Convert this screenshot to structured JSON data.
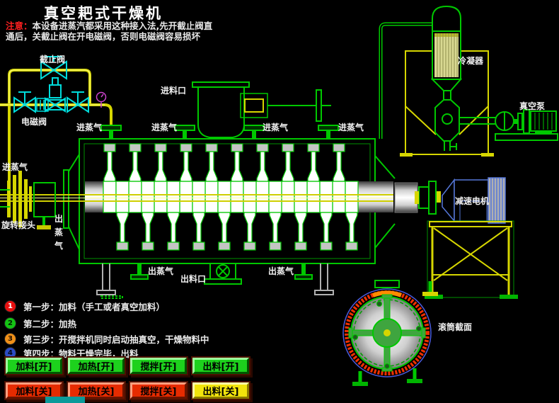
{
  "title": "真空耙式干燥机",
  "warning": {
    "prefix": "注意：",
    "line1": "本设备进蒸汽都采用这种接入法,先开截止阀直",
    "line2": "通后，关截止阀在开电磁阀，否则电磁阀容易损坏"
  },
  "labels": {
    "stop_valve": "截止阀",
    "solenoid_valve": "电磁阀",
    "feed_inlet": "进料口",
    "steam_in": "进蒸气",
    "steam_out": "出蒸气",
    "rotary_joint": "旋转接头",
    "discharge_port": "出料口",
    "condenser": "冷凝器",
    "vacuum_pump": "真空泵",
    "gear_motor": "减速电机",
    "drum_section": "滚筒截面"
  },
  "steps": [
    {
      "num": "1",
      "circle_color": "#e81010",
      "num_color": "#ffffff",
      "text": "第一步：加料（手工或者真空加料）"
    },
    {
      "num": "2",
      "circle_color": "#14c414",
      "num_color": "#002200",
      "text": "第二步：加热"
    },
    {
      "num": "3",
      "circle_color": "#f09018",
      "num_color": "#201000",
      "text": "第三步：开搅拌机同时启动抽真空，干燥物料中"
    },
    {
      "num": "4",
      "circle_color": "#2c4cc4",
      "num_color": "#000818",
      "text": "第四步：物料干燥完毕，出料"
    }
  ],
  "buttons": [
    {
      "label": "加料[开]",
      "color": "#1dd11d",
      "state": "on"
    },
    {
      "label": "加热[开]",
      "color": "#1dd11d",
      "state": "on"
    },
    {
      "label": "搅拌[开]",
      "color": "#1dd11d",
      "state": "on"
    },
    {
      "label": "出料[开]",
      "color": "#1dd11d",
      "state": "on"
    },
    {
      "label": "加料[关]",
      "color": "#e62b00",
      "state": "off"
    },
    {
      "label": "加热[关]",
      "color": "#e62b00",
      "state": "off"
    },
    {
      "label": "搅拌[关]",
      "color": "#e62b00",
      "state": "off"
    },
    {
      "label": "出料[关]",
      "color": "#f2e40c",
      "state": "off"
    }
  ],
  "colors": {
    "background": "#000000",
    "pipe_green": "#00c800",
    "pipe_yellow": "#d6d600",
    "valve_cyan": "#00dcdc",
    "gauge_magenta": "#cc44cc",
    "motor_blue": "#5577d8",
    "section_ring_red": "#f03000",
    "section_ring_orange": "#ff8c00",
    "title_color": "#ffffff",
    "warning_accent": "#ff2020"
  }
}
